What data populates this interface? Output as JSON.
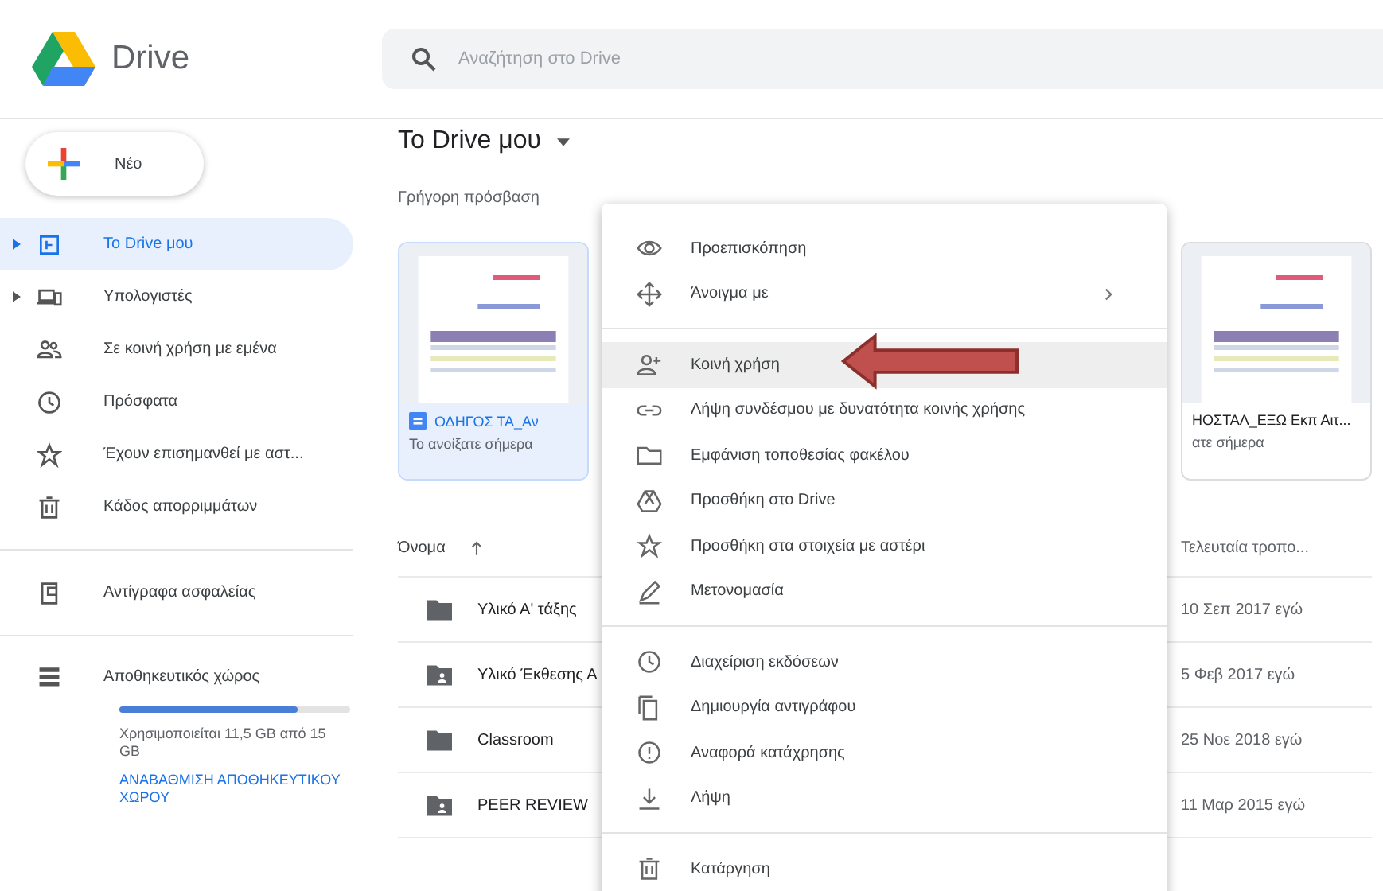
{
  "app": {
    "name": "Drive"
  },
  "search": {
    "placeholder": "Αναζήτηση στο Drive"
  },
  "new_button": {
    "label": "Νέο"
  },
  "sidebar": {
    "items": [
      {
        "label": "Το Drive μου",
        "expandable": true,
        "selected": true
      },
      {
        "label": "Υπολογιστές",
        "expandable": true,
        "selected": false
      },
      {
        "label": "Σε κοινή χρήση με εμένα",
        "expandable": false,
        "selected": false
      },
      {
        "label": "Πρόσφατα",
        "expandable": false,
        "selected": false
      },
      {
        "label": "Έχουν επισημανθεί με αστ...",
        "expandable": false,
        "selected": false
      },
      {
        "label": "Κάδος απορριμμάτων",
        "expandable": false,
        "selected": false
      },
      {
        "label": "Αντίγραφα ασφαλείας",
        "expandable": false,
        "selected": false
      }
    ],
    "storage": {
      "label": "Αποθηκευτικός χώρος",
      "level": 0.77,
      "usage": "Χρησιμοποιείται 11,5 GB από 15 GB",
      "upgrade": "ΑΝΑΒΑΘΜΙΣΗ ΑΠΟΘΗΚΕΥΤΙΚΟΥ ΧΩΡΟΥ"
    }
  },
  "main": {
    "title": "Το Drive μου",
    "quick_access": {
      "label": "Γρήγορη πρόσβαση",
      "cards": [
        {
          "name": "ΟΔΗΓΟΣ ΤΑ_Αν",
          "subtitle": "Το ανοίξατε σήμερα",
          "selected": true
        },
        {
          "name": "ΗΟΣΤΑΛ_ΕΞΩ Εκπ Αιτ...",
          "subtitle": "ατε σήμερα",
          "selected": false
        }
      ]
    },
    "files": {
      "columns": [
        "Όνομα",
        "Τελευταία τροπο..."
      ],
      "rows": [
        {
          "name": "Υλικό Α' τάξης",
          "modified": "10 Σεπ 2017 εγώ",
          "kind": "folder"
        },
        {
          "name": "Υλικό Έκθεσης Α",
          "modified": "5 Φεβ 2017 εγώ",
          "kind": "shared"
        },
        {
          "name": "Classroom",
          "modified": "25 Νοε 2018 εγώ",
          "kind": "folder"
        },
        {
          "name": "PEER REVIEW",
          "modified": "11 Μαρ 2015 εγώ",
          "kind": "shared"
        }
      ]
    }
  },
  "context_menu": {
    "sections": [
      {
        "items": [
          {
            "label": "Προεπισκόπηση",
            "submenu": false,
            "selected": false
          },
          {
            "label": "Άνοιγμα με",
            "submenu": true,
            "selected": false
          }
        ]
      },
      {
        "items": [
          {
            "label": "Κοινή χρήση",
            "submenu": false,
            "selected": true
          },
          {
            "label": "Λήψη συνδέσμου με δυνατότητα κοινής χρήσης",
            "submenu": false,
            "selected": false
          },
          {
            "label": "Εμφάνιση τοποθεσίας φακέλου",
            "submenu": false,
            "selected": false
          },
          {
            "label": "Προσθήκη στο Drive",
            "submenu": false,
            "selected": false
          },
          {
            "label": "Προσθήκη στα στοιχεία με αστέρι",
            "submenu": false,
            "selected": false
          },
          {
            "label": "Μετονομασία",
            "submenu": false,
            "selected": false
          }
        ]
      },
      {
        "items": [
          {
            "label": "Διαχείριση εκδόσεων",
            "submenu": false,
            "selected": false
          },
          {
            "label": "Δημιουργία αντιγράφου",
            "submenu": false,
            "selected": false
          },
          {
            "label": "Αναφορά κατάχρησης",
            "submenu": false,
            "selected": false
          },
          {
            "label": "Λήψη",
            "submenu": false,
            "selected": false
          }
        ]
      },
      {
        "items": [
          {
            "label": "Κατάργηση",
            "submenu": false,
            "selected": false
          }
        ]
      }
    ]
  }
}
